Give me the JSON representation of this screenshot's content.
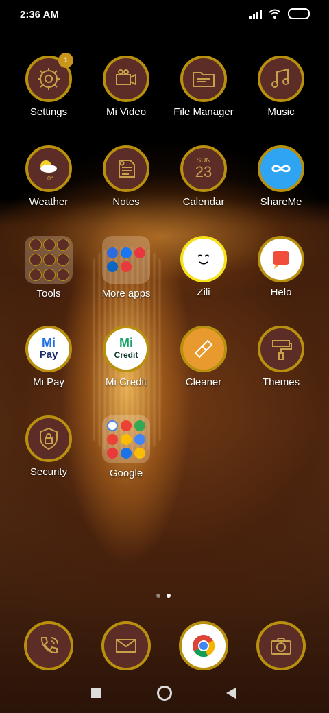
{
  "status_bar": {
    "time": "2:36 AM"
  },
  "apps": {
    "settings": {
      "label": "Settings",
      "badge": "1"
    },
    "mi_video": {
      "label": "Mi Video"
    },
    "file_manager": {
      "label": "File Manager"
    },
    "music": {
      "label": "Music"
    },
    "weather": {
      "label": "Weather",
      "temp": "0°"
    },
    "notes": {
      "label": "Notes"
    },
    "calendar": {
      "label": "Calendar",
      "day": "SUN",
      "date": "23"
    },
    "shareme": {
      "label": "ShareMe"
    },
    "tools": {
      "label": "Tools"
    },
    "more_apps": {
      "label": "More apps"
    },
    "zili": {
      "label": "Zili"
    },
    "helo": {
      "label": "Helo"
    },
    "mi_pay": {
      "label": "Mi Pay",
      "logo_top": "Mi",
      "logo_bottom": "Pay"
    },
    "mi_credit": {
      "label": "Mi Credit",
      "logo_top": "Mi",
      "logo_bottom": "Credit"
    },
    "cleaner": {
      "label": "Cleaner"
    },
    "themes": {
      "label": "Themes"
    },
    "security": {
      "label": "Security"
    },
    "google": {
      "label": "Google"
    }
  },
  "page_indicator": {
    "pages": 2,
    "current": 2
  },
  "dock": {
    "phone": "phone-icon",
    "messages": "messages-icon",
    "chrome": "chrome-icon",
    "camera": "camera-icon"
  },
  "theme": {
    "icon_bg": "#5b2d26",
    "icon_ring": "#b8900e",
    "glyph": "#c9a14a"
  }
}
